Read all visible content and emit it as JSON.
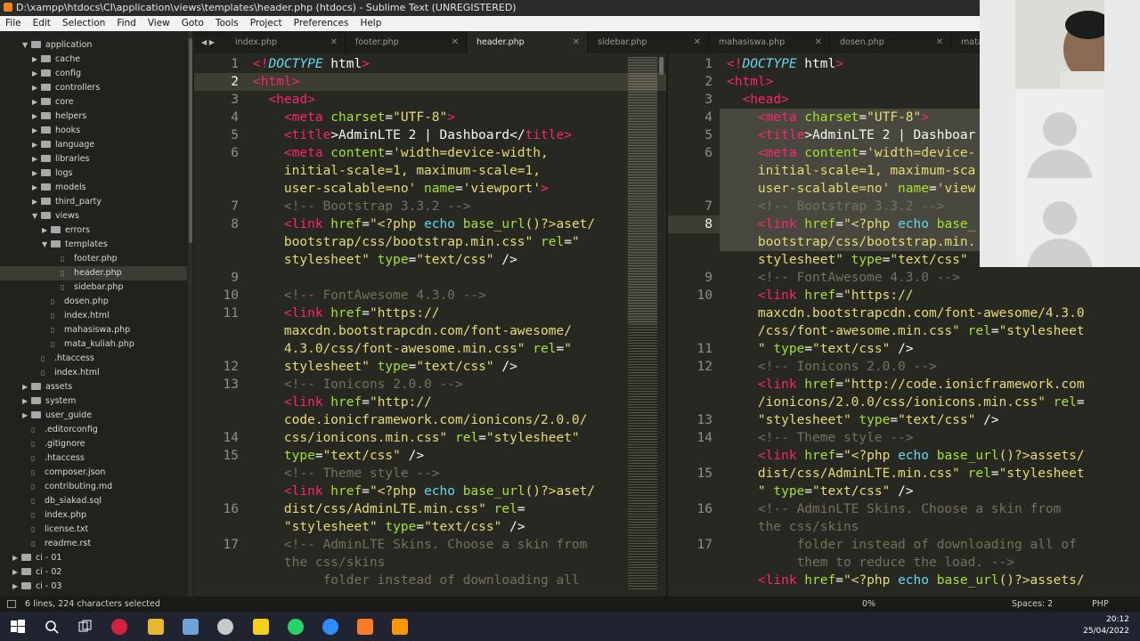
{
  "window": {
    "title": "D:\\xampp\\htdocs\\CI\\application\\views\\templates\\header.php (htdocs) - Sublime Text (UNREGISTERED)"
  },
  "menu": [
    "File",
    "Edit",
    "Selection",
    "Find",
    "View",
    "Goto",
    "Tools",
    "Project",
    "Preferences",
    "Help"
  ],
  "sidebar": {
    "items": [
      {
        "label": "application",
        "type": "folder",
        "open": true
      },
      {
        "label": "cache",
        "type": "folder"
      },
      {
        "label": "config",
        "type": "folder"
      },
      {
        "label": "controllers",
        "type": "folder"
      },
      {
        "label": "core",
        "type": "folder"
      },
      {
        "label": "helpers",
        "type": "folder"
      },
      {
        "label": "hooks",
        "type": "folder"
      },
      {
        "label": "language",
        "type": "folder"
      },
      {
        "label": "libraries",
        "type": "folder"
      },
      {
        "label": "logs",
        "type": "folder"
      },
      {
        "label": "models",
        "type": "folder"
      },
      {
        "label": "third_party",
        "type": "folder"
      },
      {
        "label": "views",
        "type": "folder",
        "open": true
      },
      {
        "label": "errors",
        "type": "folder"
      },
      {
        "label": "templates",
        "type": "folder",
        "open": true
      },
      {
        "label": "footer.php",
        "type": "file"
      },
      {
        "label": "header.php",
        "type": "file",
        "selected": true
      },
      {
        "label": "sidebar.php",
        "type": "file"
      },
      {
        "label": "dosen.php",
        "type": "file"
      },
      {
        "label": "index.html",
        "type": "file"
      },
      {
        "label": "mahasiswa.php",
        "type": "file"
      },
      {
        "label": "mata_kuliah.php",
        "type": "file"
      },
      {
        "label": ".htaccess",
        "type": "file"
      },
      {
        "label": "index.html",
        "type": "file"
      },
      {
        "label": "assets",
        "type": "folder"
      },
      {
        "label": "system",
        "type": "folder"
      },
      {
        "label": "user_guide",
        "type": "folder"
      },
      {
        "label": ".editorconfig",
        "type": "file"
      },
      {
        "label": ".gitignore",
        "type": "file"
      },
      {
        "label": ".htaccess",
        "type": "file"
      },
      {
        "label": "composer.json",
        "type": "file"
      },
      {
        "label": "contributing.md",
        "type": "file"
      },
      {
        "label": "db_siakad.sql",
        "type": "file"
      },
      {
        "label": "index.php",
        "type": "file"
      },
      {
        "label": "license.txt",
        "type": "file"
      },
      {
        "label": "readme.rst",
        "type": "file"
      },
      {
        "label": "ci - 01",
        "type": "folder"
      },
      {
        "label": "ci - 02",
        "type": "folder"
      },
      {
        "label": "ci - 03",
        "type": "folder"
      }
    ]
  },
  "tabs": [
    {
      "label": "index.php",
      "active": false
    },
    {
      "label": "footer.php",
      "active": false
    },
    {
      "label": "header.php",
      "active": true
    },
    {
      "label": "sidebar.php",
      "active": false
    },
    {
      "label": "mahasiswa.php",
      "active": false
    },
    {
      "label": "dosen.php",
      "active": false
    },
    {
      "label": "mata_",
      "active": false
    }
  ],
  "editor_left": {
    "gutter": [
      "1",
      "2",
      "3",
      "4",
      "5",
      "6",
      "",
      "",
      "7",
      "8",
      "",
      "",
      "9",
      "10",
      "11",
      "",
      "",
      "12",
      "13",
      "",
      "",
      "14",
      "15",
      "",
      "",
      "16",
      "",
      "17",
      ""
    ],
    "current_line": "2",
    "lines": [
      [
        [
          "<!",
          "t"
        ],
        [
          "DOCTYPE",
          "k"
        ],
        [
          " html",
          ""
        ],
        [
          ">",
          "t"
        ]
      ],
      [
        [
          "<",
          "t"
        ],
        [
          "html",
          "t"
        ],
        [
          ">",
          "t"
        ]
      ],
      [
        [
          "  <",
          "t"
        ],
        [
          "head",
          "t"
        ],
        [
          ">",
          "t"
        ]
      ],
      [
        [
          "    <",
          "t"
        ],
        [
          "meta",
          "t"
        ],
        [
          " charset",
          "a"
        ],
        [
          "=",
          ""
        ],
        [
          "\"UTF-8\"",
          "s"
        ],
        [
          ">",
          "t"
        ]
      ],
      [
        [
          "    <",
          "t"
        ],
        [
          "title",
          "t"
        ],
        [
          ">AdminLTE 2 | Dashboard</",
          ""
        ],
        [
          "title",
          "t"
        ],
        [
          ">",
          "t"
        ]
      ],
      [
        [
          "    <",
          "t"
        ],
        [
          "meta",
          "t"
        ],
        [
          " content",
          "a"
        ],
        [
          "=",
          ""
        ],
        [
          "'width=device-width,",
          "s"
        ]
      ],
      [
        [
          "    initial-scale=1, maximum-scale=1,",
          "s"
        ]
      ],
      [
        [
          "    user-scalable=no'",
          "s"
        ],
        [
          " name",
          "a"
        ],
        [
          "=",
          ""
        ],
        [
          "'viewport'",
          "s"
        ],
        [
          ">",
          "t"
        ]
      ],
      [
        [
          "    <!-- Bootstrap 3.3.2 -->",
          "c"
        ]
      ],
      [
        [
          "    <",
          "t"
        ],
        [
          "link",
          "t"
        ],
        [
          " href",
          "a"
        ],
        [
          "=",
          ""
        ],
        [
          "\"<?php ",
          "s"
        ],
        [
          "echo ",
          "f"
        ],
        [
          "base_url",
          "a"
        ],
        [
          "()?>aset/",
          "s"
        ]
      ],
      [
        [
          "    bootstrap/css/bootstrap.min.css\"",
          "s"
        ],
        [
          " rel",
          "a"
        ],
        [
          "=",
          ""
        ],
        [
          "\"",
          "s"
        ]
      ],
      [
        [
          "    stylesheet\"",
          "s"
        ],
        [
          " type",
          "a"
        ],
        [
          "=",
          ""
        ],
        [
          "\"text/css\"",
          "s"
        ],
        [
          " />",
          ""
        ]
      ],
      [
        [
          "",
          ""
        ]
      ],
      [
        [
          "    <!-- FontAwesome 4.3.0 -->",
          "c"
        ]
      ],
      [
        [
          "    <",
          "t"
        ],
        [
          "link",
          "t"
        ],
        [
          " href",
          "a"
        ],
        [
          "=",
          ""
        ],
        [
          "\"https://",
          "s"
        ]
      ],
      [
        [
          "    maxcdn.bootstrapcdn.com/font-awesome/",
          "s"
        ]
      ],
      [
        [
          "    4.3.0/css/font-awesome.min.css\"",
          "s"
        ],
        [
          " rel",
          "a"
        ],
        [
          "=",
          ""
        ],
        [
          "\"",
          "s"
        ]
      ],
      [
        [
          "    stylesheet\"",
          "s"
        ],
        [
          " type",
          "a"
        ],
        [
          "=",
          ""
        ],
        [
          "\"text/css\"",
          "s"
        ],
        [
          " />",
          ""
        ]
      ],
      [
        [
          "    <!-- Ionicons 2.0.0 -->",
          "c"
        ]
      ],
      [
        [
          "    <",
          "t"
        ],
        [
          "link",
          "t"
        ],
        [
          " href",
          "a"
        ],
        [
          "=",
          ""
        ],
        [
          "\"http://",
          "s"
        ]
      ],
      [
        [
          "    code.ionicframework.com/ionicons/2.0.0/",
          "s"
        ]
      ],
      [
        [
          "    css/ionicons.min.css\"",
          "s"
        ],
        [
          " rel",
          "a"
        ],
        [
          "=",
          ""
        ],
        [
          "\"stylesheet\"",
          "s"
        ]
      ],
      [
        [
          "    type",
          "a"
        ],
        [
          "=",
          ""
        ],
        [
          "\"text/css\"",
          "s"
        ],
        [
          " />",
          ""
        ]
      ],
      [
        [
          "    <!-- Theme style -->",
          "c"
        ]
      ],
      [
        [
          "    <",
          "t"
        ],
        [
          "link",
          "t"
        ],
        [
          " href",
          "a"
        ],
        [
          "=",
          ""
        ],
        [
          "\"<?php ",
          "s"
        ],
        [
          "echo ",
          "f"
        ],
        [
          "base_url",
          "a"
        ],
        [
          "()?>aset/",
          "s"
        ]
      ],
      [
        [
          "    dist/css/AdminLTE.min.css\"",
          "s"
        ],
        [
          " rel",
          "a"
        ],
        [
          "=",
          ""
        ]
      ],
      [
        [
          "    \"stylesheet\"",
          "s"
        ],
        [
          " type",
          "a"
        ],
        [
          "=",
          ""
        ],
        [
          "\"text/css\"",
          "s"
        ],
        [
          " />",
          ""
        ]
      ],
      [
        [
          "    <!-- AdminLTE Skins. Choose a skin from",
          "c"
        ]
      ],
      [
        [
          "    the css/skins",
          "c"
        ]
      ],
      [
        [
          "         folder instead of downloading all",
          "c"
        ]
      ]
    ]
  },
  "editor_right": {
    "gutter": [
      "1",
      "2",
      "3",
      "4",
      "5",
      "6",
      "",
      "",
      "7",
      "8",
      "",
      "",
      "9",
      "10",
      "",
      "",
      "11",
      "12",
      "",
      "",
      "13",
      "14",
      "",
      "15",
      "",
      "16",
      "",
      "17"
    ],
    "current_line": "8",
    "lines": [
      [
        [
          "<!",
          "t"
        ],
        [
          "DOCTYPE",
          "k"
        ],
        [
          " html",
          ""
        ],
        [
          ">",
          "t"
        ]
      ],
      [
        [
          "<",
          "t"
        ],
        [
          "html",
          "t"
        ],
        [
          ">",
          "t"
        ]
      ],
      [
        [
          "  <",
          "t"
        ],
        [
          "head",
          "t"
        ],
        [
          ">",
          "t"
        ]
      ],
      [
        [
          "    <",
          "t"
        ],
        [
          "meta",
          "t"
        ],
        [
          " charset",
          "a"
        ],
        [
          "=",
          ""
        ],
        [
          "\"UTF-8\"",
          "s"
        ],
        [
          ">",
          "t"
        ]
      ],
      [
        [
          "    <",
          "t"
        ],
        [
          "title",
          "t"
        ],
        [
          ">AdminLTE 2 | Dashboar",
          ""
        ]
      ],
      [
        [
          "    <",
          "t"
        ],
        [
          "meta",
          "t"
        ],
        [
          " content",
          "a"
        ],
        [
          "=",
          ""
        ],
        [
          "'width=device-",
          "s"
        ]
      ],
      [
        [
          "    initial-scale=1, maximum-sca",
          "s"
        ]
      ],
      [
        [
          "    user-scalable=no'",
          "s"
        ],
        [
          " name",
          "a"
        ],
        [
          "=",
          ""
        ],
        [
          "'view",
          "s"
        ]
      ],
      [
        [
          "    <!-- Bootstrap 3.3.2 -->",
          "c"
        ]
      ],
      [
        [
          "    <",
          "t"
        ],
        [
          "link",
          "t"
        ],
        [
          " href",
          "a"
        ],
        [
          "=",
          ""
        ],
        [
          "\"<?php ",
          "s"
        ],
        [
          "echo ",
          "f"
        ],
        [
          "base_",
          "a"
        ]
      ],
      [
        [
          "    bootstrap/css/bootstrap.min.",
          "s"
        ]
      ],
      [
        [
          "    stylesheet\"",
          "s"
        ],
        [
          " type",
          "a"
        ],
        [
          "=",
          ""
        ],
        [
          "\"text/css\"",
          "s"
        ]
      ],
      [
        [
          "    <!-- FontAwesome 4.3.0 -->",
          "c"
        ]
      ],
      [
        [
          "    <",
          "t"
        ],
        [
          "link",
          "t"
        ],
        [
          " href",
          "a"
        ],
        [
          "=",
          ""
        ],
        [
          "\"https://",
          "s"
        ]
      ],
      [
        [
          "    maxcdn.bootstrapcdn.com/font-awesome/4.3.0",
          "s"
        ]
      ],
      [
        [
          "    /css/font-awesome.min.css\"",
          "s"
        ],
        [
          " rel",
          "a"
        ],
        [
          "=",
          ""
        ],
        [
          "\"stylesheet",
          "s"
        ]
      ],
      [
        [
          "    \"",
          "s"
        ],
        [
          " type",
          "a"
        ],
        [
          "=",
          ""
        ],
        [
          "\"text/css\"",
          "s"
        ],
        [
          " />",
          ""
        ]
      ],
      [
        [
          "    <!-- Ionicons 2.0.0 -->",
          "c"
        ]
      ],
      [
        [
          "    <",
          "t"
        ],
        [
          "link",
          "t"
        ],
        [
          " href",
          "a"
        ],
        [
          "=",
          ""
        ],
        [
          "\"http://code.ionicframework.com",
          "s"
        ]
      ],
      [
        [
          "    /ionicons/2.0.0/css/ionicons.min.css\"",
          "s"
        ],
        [
          " rel",
          "a"
        ],
        [
          "=",
          ""
        ]
      ],
      [
        [
          "    \"stylesheet\"",
          "s"
        ],
        [
          " type",
          "a"
        ],
        [
          "=",
          ""
        ],
        [
          "\"text/css\"",
          "s"
        ],
        [
          " />",
          ""
        ]
      ],
      [
        [
          "    <!-- Theme style -->",
          "c"
        ]
      ],
      [
        [
          "    <",
          "t"
        ],
        [
          "link",
          "t"
        ],
        [
          " href",
          "a"
        ],
        [
          "=",
          ""
        ],
        [
          "\"<?php ",
          "s"
        ],
        [
          "echo ",
          "f"
        ],
        [
          "base_url",
          "a"
        ],
        [
          "()?>assets/",
          "s"
        ]
      ],
      [
        [
          "    dist/css/AdminLTE.min.css\"",
          "s"
        ],
        [
          " rel",
          "a"
        ],
        [
          "=",
          ""
        ],
        [
          "\"stylesheet",
          "s"
        ]
      ],
      [
        [
          "    \"",
          "s"
        ],
        [
          " type",
          "a"
        ],
        [
          "=",
          ""
        ],
        [
          "\"text/css\"",
          "s"
        ],
        [
          " />",
          ""
        ]
      ],
      [
        [
          "    <!-- AdminLTE Skins. Choose a skin from",
          "c"
        ]
      ],
      [
        [
          "    the css/skins",
          "c"
        ]
      ],
      [
        [
          "         folder instead of downloading all of",
          "c"
        ]
      ],
      [
        [
          "         them to reduce the load. -->",
          "c"
        ]
      ],
      [
        [
          "    <",
          "t"
        ],
        [
          "link",
          "t"
        ],
        [
          " href",
          "a"
        ],
        [
          "=",
          ""
        ],
        [
          "\"<?php ",
          "s"
        ],
        [
          "echo ",
          "f"
        ],
        [
          "base_url",
          "a"
        ],
        [
          "()?>assets/",
          "s"
        ]
      ]
    ]
  },
  "status": {
    "left": "6 lines, 224 characters selected",
    "mid": "0%",
    "spaces": "Spaces: 2",
    "lang": "PHP"
  },
  "clock": {
    "time": "20:12",
    "date": "25/04/2022"
  },
  "colors": {
    "bg": "#272822",
    "tag": "#f92672",
    "string": "#e6db74",
    "attr": "#a6e22e",
    "comment": "#75715e",
    "func": "#66d9ef"
  }
}
